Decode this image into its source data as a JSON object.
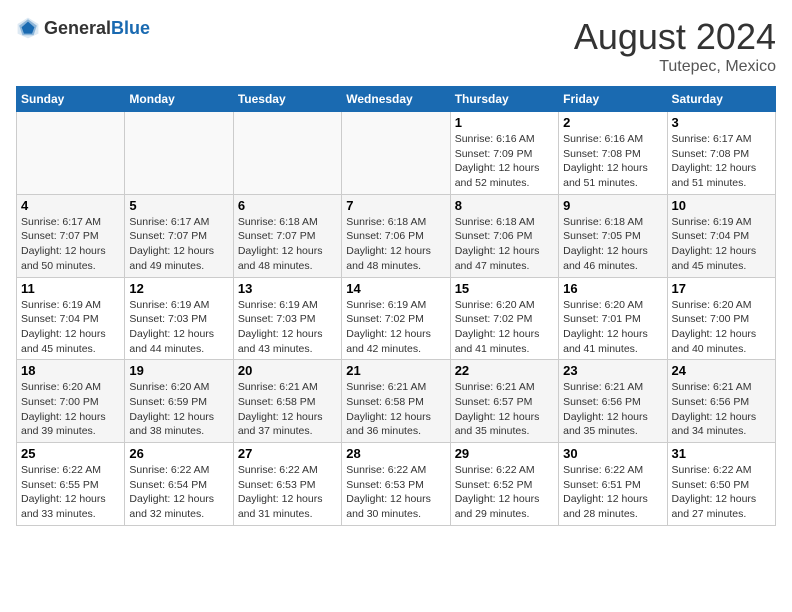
{
  "header": {
    "logo_general": "General",
    "logo_blue": "Blue",
    "month_year": "August 2024",
    "location": "Tutepec, Mexico"
  },
  "days_of_week": [
    "Sunday",
    "Monday",
    "Tuesday",
    "Wednesday",
    "Thursday",
    "Friday",
    "Saturday"
  ],
  "weeks": [
    [
      {
        "day": "",
        "info": ""
      },
      {
        "day": "",
        "info": ""
      },
      {
        "day": "",
        "info": ""
      },
      {
        "day": "",
        "info": ""
      },
      {
        "day": "1",
        "info": "Sunrise: 6:16 AM\nSunset: 7:09 PM\nDaylight: 12 hours\nand 52 minutes."
      },
      {
        "day": "2",
        "info": "Sunrise: 6:16 AM\nSunset: 7:08 PM\nDaylight: 12 hours\nand 51 minutes."
      },
      {
        "day": "3",
        "info": "Sunrise: 6:17 AM\nSunset: 7:08 PM\nDaylight: 12 hours\nand 51 minutes."
      }
    ],
    [
      {
        "day": "4",
        "info": "Sunrise: 6:17 AM\nSunset: 7:07 PM\nDaylight: 12 hours\nand 50 minutes."
      },
      {
        "day": "5",
        "info": "Sunrise: 6:17 AM\nSunset: 7:07 PM\nDaylight: 12 hours\nand 49 minutes."
      },
      {
        "day": "6",
        "info": "Sunrise: 6:18 AM\nSunset: 7:07 PM\nDaylight: 12 hours\nand 48 minutes."
      },
      {
        "day": "7",
        "info": "Sunrise: 6:18 AM\nSunset: 7:06 PM\nDaylight: 12 hours\nand 48 minutes."
      },
      {
        "day": "8",
        "info": "Sunrise: 6:18 AM\nSunset: 7:06 PM\nDaylight: 12 hours\nand 47 minutes."
      },
      {
        "day": "9",
        "info": "Sunrise: 6:18 AM\nSunset: 7:05 PM\nDaylight: 12 hours\nand 46 minutes."
      },
      {
        "day": "10",
        "info": "Sunrise: 6:19 AM\nSunset: 7:04 PM\nDaylight: 12 hours\nand 45 minutes."
      }
    ],
    [
      {
        "day": "11",
        "info": "Sunrise: 6:19 AM\nSunset: 7:04 PM\nDaylight: 12 hours\nand 45 minutes."
      },
      {
        "day": "12",
        "info": "Sunrise: 6:19 AM\nSunset: 7:03 PM\nDaylight: 12 hours\nand 44 minutes."
      },
      {
        "day": "13",
        "info": "Sunrise: 6:19 AM\nSunset: 7:03 PM\nDaylight: 12 hours\nand 43 minutes."
      },
      {
        "day": "14",
        "info": "Sunrise: 6:19 AM\nSunset: 7:02 PM\nDaylight: 12 hours\nand 42 minutes."
      },
      {
        "day": "15",
        "info": "Sunrise: 6:20 AM\nSunset: 7:02 PM\nDaylight: 12 hours\nand 41 minutes."
      },
      {
        "day": "16",
        "info": "Sunrise: 6:20 AM\nSunset: 7:01 PM\nDaylight: 12 hours\nand 41 minutes."
      },
      {
        "day": "17",
        "info": "Sunrise: 6:20 AM\nSunset: 7:00 PM\nDaylight: 12 hours\nand 40 minutes."
      }
    ],
    [
      {
        "day": "18",
        "info": "Sunrise: 6:20 AM\nSunset: 7:00 PM\nDaylight: 12 hours\nand 39 minutes."
      },
      {
        "day": "19",
        "info": "Sunrise: 6:20 AM\nSunset: 6:59 PM\nDaylight: 12 hours\nand 38 minutes."
      },
      {
        "day": "20",
        "info": "Sunrise: 6:21 AM\nSunset: 6:58 PM\nDaylight: 12 hours\nand 37 minutes."
      },
      {
        "day": "21",
        "info": "Sunrise: 6:21 AM\nSunset: 6:58 PM\nDaylight: 12 hours\nand 36 minutes."
      },
      {
        "day": "22",
        "info": "Sunrise: 6:21 AM\nSunset: 6:57 PM\nDaylight: 12 hours\nand 35 minutes."
      },
      {
        "day": "23",
        "info": "Sunrise: 6:21 AM\nSunset: 6:56 PM\nDaylight: 12 hours\nand 35 minutes."
      },
      {
        "day": "24",
        "info": "Sunrise: 6:21 AM\nSunset: 6:56 PM\nDaylight: 12 hours\nand 34 minutes."
      }
    ],
    [
      {
        "day": "25",
        "info": "Sunrise: 6:22 AM\nSunset: 6:55 PM\nDaylight: 12 hours\nand 33 minutes."
      },
      {
        "day": "26",
        "info": "Sunrise: 6:22 AM\nSunset: 6:54 PM\nDaylight: 12 hours\nand 32 minutes."
      },
      {
        "day": "27",
        "info": "Sunrise: 6:22 AM\nSunset: 6:53 PM\nDaylight: 12 hours\nand 31 minutes."
      },
      {
        "day": "28",
        "info": "Sunrise: 6:22 AM\nSunset: 6:53 PM\nDaylight: 12 hours\nand 30 minutes."
      },
      {
        "day": "29",
        "info": "Sunrise: 6:22 AM\nSunset: 6:52 PM\nDaylight: 12 hours\nand 29 minutes."
      },
      {
        "day": "30",
        "info": "Sunrise: 6:22 AM\nSunset: 6:51 PM\nDaylight: 12 hours\nand 28 minutes."
      },
      {
        "day": "31",
        "info": "Sunrise: 6:22 AM\nSunset: 6:50 PM\nDaylight: 12 hours\nand 27 minutes."
      }
    ]
  ]
}
